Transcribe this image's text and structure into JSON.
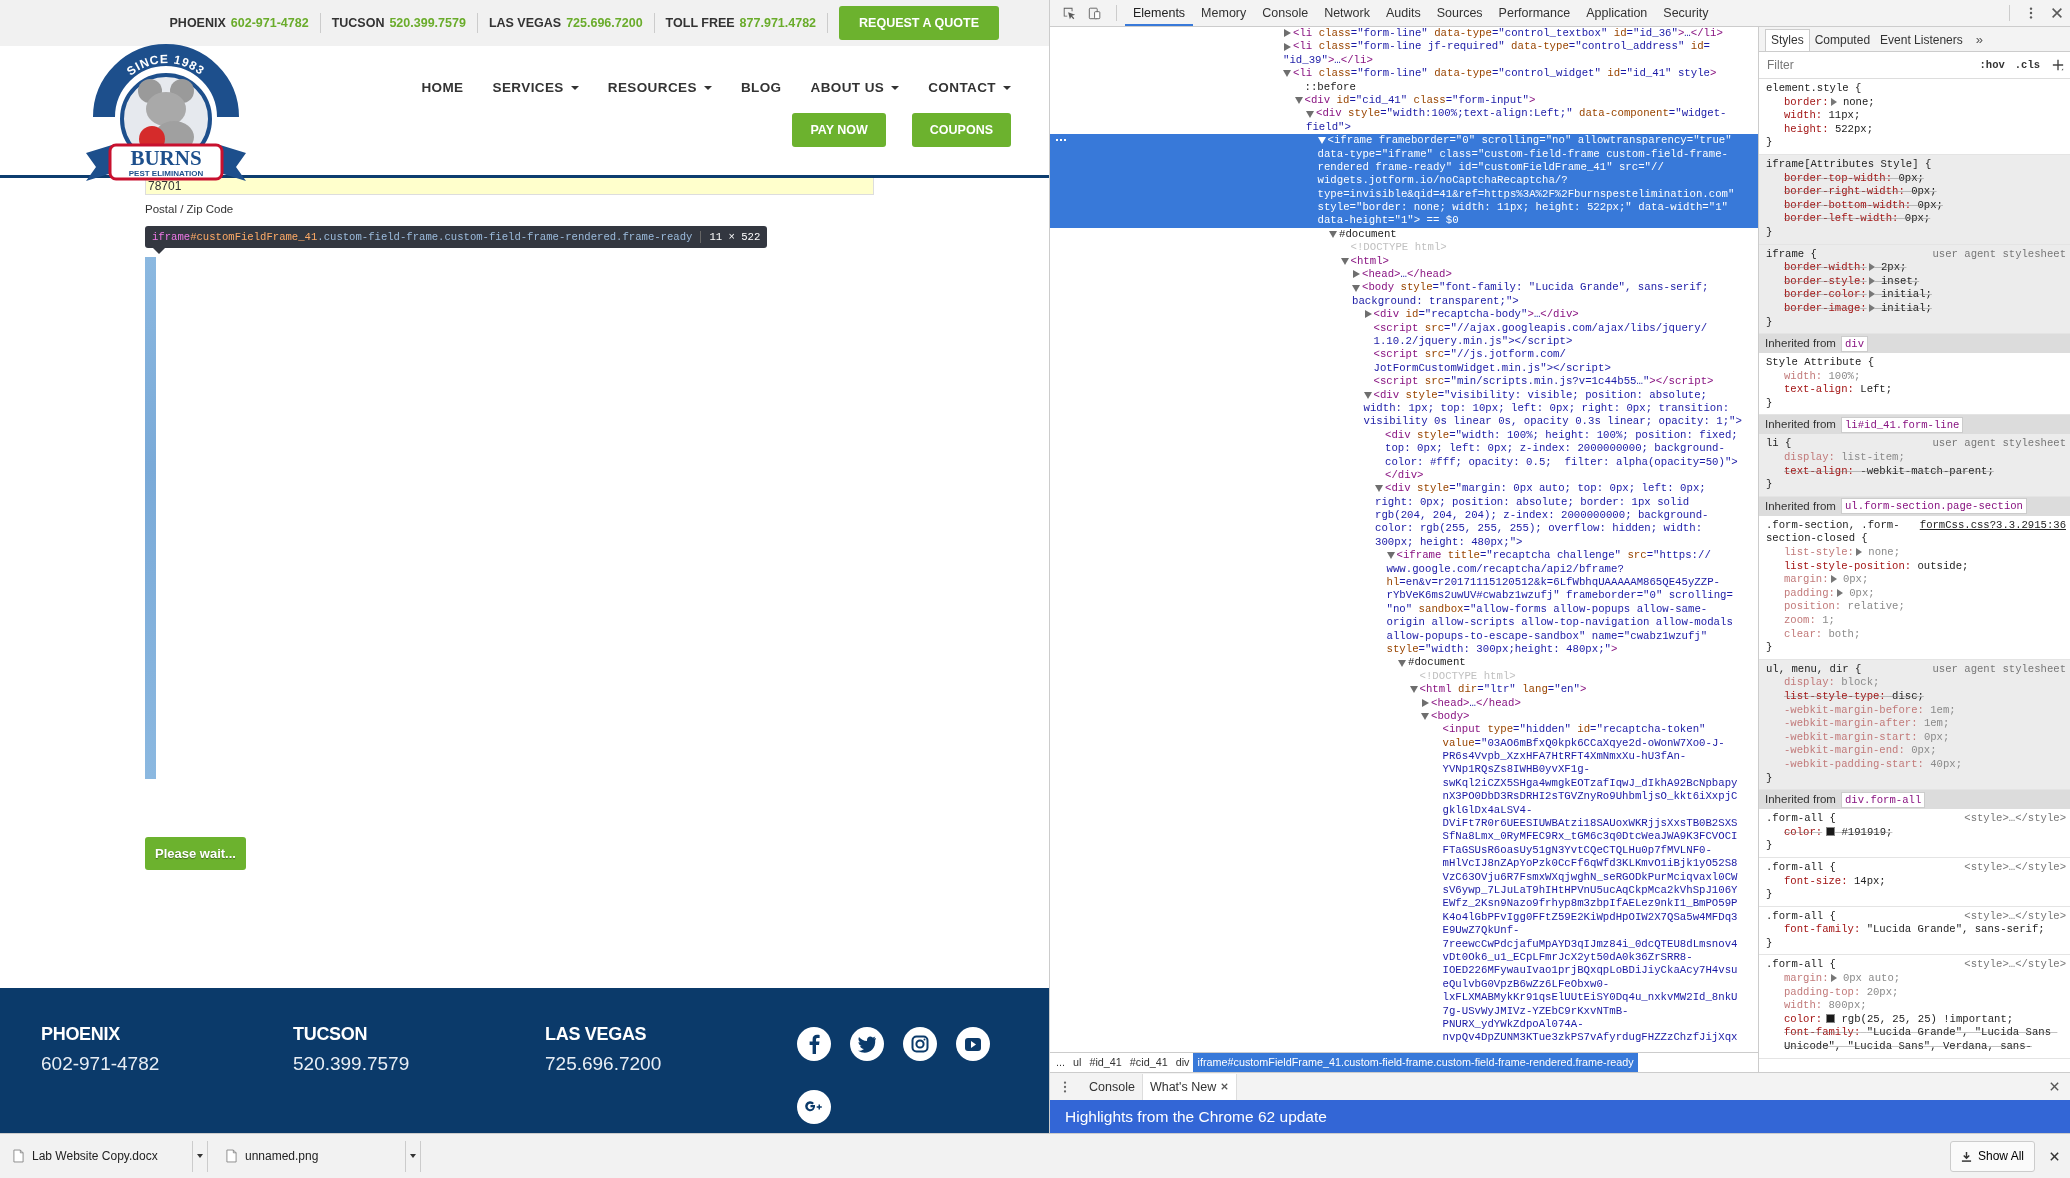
{
  "site": {
    "topbar": {
      "locations": [
        {
          "city": "PHOENIX",
          "phone": "602-971-4782"
        },
        {
          "city": "TUCSON",
          "phone": "520.399.7579"
        },
        {
          "city": "LAS VEGAS",
          "phone": "725.696.7200"
        },
        {
          "city": "TOLL FREE",
          "phone": "877.971.4782"
        }
      ],
      "quote_button": "REQUEST A QUOTE"
    },
    "logo": {
      "arc_text": "SINCE 1983",
      "name": "BURNS",
      "tagline": "PEST ELIMINATION"
    },
    "nav": [
      {
        "label": "HOME",
        "dropdown": false
      },
      {
        "label": "SERVICES",
        "dropdown": true
      },
      {
        "label": "RESOURCES",
        "dropdown": true
      },
      {
        "label": "BLOG",
        "dropdown": false
      },
      {
        "label": "ABOUT US",
        "dropdown": true
      },
      {
        "label": "CONTACT",
        "dropdown": true
      }
    ],
    "header_buttons": [
      "PAY NOW",
      "COUPONS"
    ],
    "form": {
      "zip_value": "78701",
      "zip_label": "Postal / Zip Code",
      "submit": "Please wait..."
    },
    "inspect_tooltip": {
      "tag": "iframe",
      "id": "#customFieldFrame_41",
      "classes": ".custom-field-frame.custom-field-frame-rendered.frame-ready",
      "size": "11 × 522"
    },
    "footer": {
      "offices": [
        {
          "city": "PHOENIX",
          "phone": "602-971-4782"
        },
        {
          "city": "TUCSON",
          "phone": "520.399.7579"
        },
        {
          "city": "LAS VEGAS",
          "phone": "725.696.7200"
        }
      ]
    }
  },
  "devtools": {
    "tabs": [
      {
        "label": "Elements",
        "selected": true
      },
      {
        "label": "Memory",
        "selected": false
      },
      {
        "label": "Console",
        "selected": false
      },
      {
        "label": "Network",
        "selected": false
      },
      {
        "label": "Audits",
        "selected": false
      },
      {
        "label": "Sources",
        "selected": false
      },
      {
        "label": "Performance",
        "selected": false
      },
      {
        "label": "Application",
        "selected": false
      },
      {
        "label": "Security",
        "selected": false
      }
    ],
    "dom_tree": [
      {
        "kind": "element",
        "lines": [
          "<li class=\"form-line\" data-type=\"control_textbox\" id=\"id_36\">…</li>"
        ],
        "expanded": false,
        "selected": false
      },
      {
        "kind": "element",
        "lines": [
          "<li class=\"form-line jf-required\" data-type=\"control_address\" id=",
          "\"id_39\">…</li>"
        ],
        "expanded": false,
        "selected": false
      },
      {
        "kind": "element",
        "lines": [
          "<li class=\"form-line\" data-type=\"control_widget\" id=\"id_41\" style>"
        ],
        "expanded": true,
        "selected": false,
        "children": [
          {
            "kind": "pseudo",
            "lines": [
              "::before"
            ],
            "selected": false
          },
          {
            "kind": "element",
            "lines": [
              "<div id=\"cid_41\" class=\"form-input\">"
            ],
            "expanded": true,
            "selected": false,
            "children": [
              {
                "kind": "element",
                "lines": [
                  "<div style=\"width:100%;text-align:Left;\" data-component=\"widget-",
                  "field\">"
                ],
                "expanded": true,
                "selected": false,
                "children": [
                  {
                    "kind": "element",
                    "lines": [
                      "<iframe frameborder=\"0\" scrolling=\"no\" allowtransparency=\"true\"",
                      "data-type=\"iframe\" class=\"custom-field-frame custom-field-frame-",
                      "rendered frame-ready\" id=\"customFieldFrame_41\" src=\"//",
                      "widgets.jotform.io/noCaptchaRecaptcha/?",
                      "type=invisible&qid=41&ref=https%3A%2F%2Fburnspestelimination.com\"",
                      "style=\"border: none; width: 11px; height: 522px;\" data-width=\"1\"",
                      "data-height=\"1\"> == $0"
                    ],
                    "expanded": true,
                    "selected": true,
                    "children": [
                      {
                        "kind": "document",
                        "lines": [
                          "#document"
                        ],
                        "expanded": true,
                        "selected": false,
                        "children": [
                          {
                            "kind": "doctype",
                            "lines": [
                              "<!DOCTYPE html>"
                            ],
                            "selected": false
                          },
                          {
                            "kind": "element",
                            "lines": [
                              "<html>"
                            ],
                            "expanded": true,
                            "selected": false,
                            "children": [
                              {
                                "kind": "element",
                                "lines": [
                                  "<head>…</head>"
                                ],
                                "expanded": false,
                                "selected": false
                              },
                              {
                                "kind": "element",
                                "lines": [
                                  "<body style=\"font-family: \"Lucida Grande\", sans-serif;",
                                  "background: transparent;\">"
                                ],
                                "expanded": true,
                                "selected": false,
                                "children": [
                                  {
                                    "kind": "element",
                                    "lines": [
                                      "<div id=\"recaptcha-body\">…</div>"
                                    ],
                                    "expanded": false,
                                    "selected": false
                                  },
                                  {
                                    "kind": "element",
                                    "lines": [
                                      "<script src=\"//ajax.googleapis.com/ajax/libs/jquery/",
                                      "1.10.2/jquery.min.js\"></script>"
                                    ],
                                    "selected": false
                                  },
                                  {
                                    "kind": "element",
                                    "lines": [
                                      "<script src=\"//js.jotform.com/",
                                      "JotFormCustomWidget.min.js\"></script>"
                                    ],
                                    "selected": false
                                  },
                                  {
                                    "kind": "element",
                                    "lines": [
                                      "<script src=\"min/scripts.min.js?v=1c44b55…\"></script>"
                                    ],
                                    "selected": false
                                  },
                                  {
                                    "kind": "element",
                                    "lines": [
                                      "<div style=\"visibility: visible; position: absolute;",
                                      "width: 1px; top: 10px; left: 0px; right: 0px; transition:",
                                      "visibility 0s linear 0s, opacity 0.3s linear; opacity: 1;\">"
                                    ],
                                    "expanded": true,
                                    "selected": false,
                                    "children": [
                                      {
                                        "kind": "element",
                                        "lines": [
                                          "<div style=\"width: 100%; height: 100%; position: fixed;",
                                          "top: 0px; left: 0px; z-index: 2000000000; background-",
                                          "color: #fff; opacity: 0.5;  filter: alpha(opacity=50)\">",
                                          "</div>"
                                        ],
                                        "selected": false
                                      },
                                      {
                                        "kind": "element",
                                        "lines": [
                                          "<div style=\"margin: 0px auto; top: 0px; left: 0px;",
                                          "right: 0px; position: absolute; border: 1px solid",
                                          "rgb(204, 204, 204); z-index: 2000000000; background-",
                                          "color: rgb(255, 255, 255); overflow: hidden; width:",
                                          "300px; height: 480px;\">"
                                        ],
                                        "expanded": true,
                                        "selected": false,
                                        "children": [
                                          {
                                            "kind": "element",
                                            "lines": [
                                              "<iframe title=\"recaptcha challenge\" src=\"https://",
                                              "www.google.com/recaptcha/api2/bframe?",
                                              "hl=en&v=r20171115120512&k=6LfWbhqUAAAAAM865QE45yZZP-",
                                              "rYbVeK6ms2uwUV#cwabz1wzufj\" frameborder=\"0\" scrolling=",
                                              "\"no\" sandbox=\"allow-forms allow-popups allow-same-",
                                              "origin allow-scripts allow-top-navigation allow-modals",
                                              "allow-popups-to-escape-sandbox\" name=\"cwabz1wzufj\"",
                                              "style=\"width: 300px;height: 480px;\">"
                                            ],
                                            "expanded": true,
                                            "selected": false,
                                            "children": [
                                              {
                                                "kind": "document",
                                                "lines": [
                                                  "#document"
                                                ],
                                                "expanded": true,
                                                "selected": false,
                                                "children": [
                                                  {
                                                    "kind": "doctype",
                                                    "lines": [
                                                      "<!DOCTYPE html>"
                                                    ],
                                                    "selected": false
                                                  },
                                                  {
                                                    "kind": "element",
                                                    "lines": [
                                                      "<html dir=\"ltr\" lang=\"en\">"
                                                    ],
                                                    "expanded": true,
                                                    "selected": false,
                                                    "children": [
                                                      {
                                                        "kind": "element",
                                                        "lines": [
                                                          "<head>…</head>"
                                                        ],
                                                        "expanded": false,
                                                        "selected": false
                                                      },
                                                      {
                                                        "kind": "element",
                                                        "lines": [
                                                          "<body>"
                                                        ],
                                                        "expanded": true,
                                                        "selected": false,
                                                        "children": [
                                                          {
                                                            "kind": "element",
                                                            "lines": [
                                                              "<input type=\"hidden\" id=\"recaptcha-token\"",
                                                              "value=\"03AO6mBfxQ0kpk6CCaXqye2d-oWonW7Xo0-J-",
                                                              "PR6s4Vvpb_XzxHFA7HtRFT4XmNmxXu-hU3fAn-",
                                                              "YVNp1RQsZs8IWHB0yvXF1g-",
                                                              "swKql2iCZX5SHga4wmgkEOTzafIqwJ_dIkhA92BcNpbapy",
                                                              "nX3PO0DbD3RsDRHI2sTGVZnyRo9UhbmljsO_kkt6iXxpjC",
                                                              "gklGlDx4aLSV4-",
                                                              "DViFt7R0r6UEESIUWBAtzi18SAUoxWKRjjsXxsTB0B2SXS",
                                                              "SfNa8Lmx_0RyMFEC9Rx_tGM6c3q0DtcWeaJWA9K3FCVOCI",
                                                              "FTaGSUsR6oasUy51gN3YvtCQeCTQLHu0p7fMVLNF0-",
                                                              "mHlVcIJ8nZApYoPzk0CcFf6qWfd3KLKmvO1iBjk1yO52S8",
                                                              "VzC63OVju6R7FsmxWXqjwghN_seRGODkPurMciqvaxl0CW",
                                                              "sV6ywp_7LJuLaT9hIHtHPVnU5ucAqCkpMca2kVhSpJ106Y",
                                                              "EWfz_2Ksn9Nazo9frhyp8m3zbpIfAELez9nkI1_BmPO59P",
                                                              "K4o4lGbPFvIgg0FFtZ59E2KiWpdHpOIW2X7QSa5w4MFDq3",
                                                              "E9UwZ7QkUnf-",
                                                              "7reewcCwPdcjafuMpAYD3qIJmz84i_0dcQTEU8dLmsnov4",
                                                              "vDt0Ok6_u1_ECpLFmrJcX2yt50dA0k36ZrSRR8-",
                                                              "IOED226MFywauIvao1prjBQxqpLoBDiJiyCkaAcy7H4vsu",
                                                              "eQulvbG0VpzB6wZz6LFeObxw0-",
                                                              "lxFLXMABMykKr91qsElUUtEiSY0Dq4u_nxkvMW2Id_8nkU",
                                                              "7g-USvWyJMIVz-YZEbC9rKxvNTmB-",
                                                              "PNURX_ydYWkZdpoAl074A-",
                                                              "nvpQv4DpZUNM3KTue3zkPS7vAfyrdugFHZZzChzfJijXqx"
                                                            ],
                                                            "selected": false
                                                          }
                                                        ]
                                                      }
                                                    ]
                                                  }
                                                ]
                                              }
                                            ]
                                          }
                                        ]
                                      }
                                    ]
                                  }
                                ]
                              }
                            ]
                          }
                        ]
                      }
                    ]
                  }
                ]
              }
            ]
          }
        ]
      }
    ],
    "breadcrumbs": [
      {
        "label": "...",
        "selected": false
      },
      {
        "label": "ul",
        "selected": false
      },
      {
        "label": "#id_41",
        "selected": false
      },
      {
        "label": "#cid_41",
        "selected": false
      },
      {
        "label": "div",
        "selected": false
      },
      {
        "label": "iframe#customFieldFrame_41.custom-field-frame.custom-field-frame-rendered.frame-ready",
        "selected": true
      }
    ],
    "sidebar_tabs": [
      {
        "label": "Styles",
        "selected": true
      },
      {
        "label": "Computed",
        "selected": false
      },
      {
        "label": "Event Listeners",
        "selected": false
      }
    ],
    "sidebar_more": "»",
    "filter": {
      "placeholder": "Filter",
      "toggles": [
        ":hov",
        ".cls"
      ]
    },
    "style_rules": [
      {
        "kind": "rule",
        "shaded": false,
        "selector": "element.style {",
        "props": [
          {
            "name": "border:",
            "value": "none;",
            "inactive": false,
            "overridden": false,
            "expandable": true
          },
          {
            "name": "width:",
            "value": "11px;",
            "inactive": false,
            "overridden": false
          },
          {
            "name": "height:",
            "value": "522px;",
            "inactive": false,
            "overridden": false
          }
        ],
        "end": "}"
      },
      {
        "kind": "rule",
        "shaded": true,
        "selector": "iframe[Attributes Style] {",
        "props": [
          {
            "name": "border-top-width:",
            "value": "0px;",
            "inactive": false,
            "overridden": true
          },
          {
            "name": "border-right-width:",
            "value": "0px;",
            "inactive": false,
            "overridden": true
          },
          {
            "name": "border-bottom-width:",
            "value": "0px;",
            "inactive": false,
            "overridden": true
          },
          {
            "name": "border-left-width:",
            "value": "0px;",
            "inactive": false,
            "overridden": true
          }
        ],
        "end": "}"
      },
      {
        "kind": "rule",
        "shaded": true,
        "source_link": false,
        "selector": "iframe {",
        "source": "user agent stylesheet",
        "props": [
          {
            "name": "border-width:",
            "value": "2px;",
            "inactive": false,
            "overridden": true,
            "expandable": true
          },
          {
            "name": "border-style:",
            "value": "inset;",
            "inactive": false,
            "overridden": true,
            "expandable": true
          },
          {
            "name": "border-color:",
            "value": "initial;",
            "inactive": false,
            "overridden": true,
            "expandable": true
          },
          {
            "name": "border-image:",
            "value": "initial;",
            "inactive": false,
            "overridden": true,
            "expandable": true
          }
        ],
        "end": "}"
      },
      {
        "kind": "inherited",
        "label": "Inherited from",
        "target": "div"
      },
      {
        "kind": "rule",
        "shaded": false,
        "selector": "Style Attribute {",
        "props": [
          {
            "name": "width:",
            "value": "100%;",
            "inactive": true,
            "overridden": false
          },
          {
            "name": "text-align:",
            "value": "Left;",
            "inactive": false,
            "overridden": false
          }
        ],
        "end": "}"
      },
      {
        "kind": "inherited",
        "label": "Inherited from",
        "target": "li#id_41.form-line"
      },
      {
        "kind": "rule",
        "shaded": true,
        "source_link": false,
        "selector": "li {",
        "source": "user agent stylesheet",
        "props": [
          {
            "name": "display:",
            "value": "list-item;",
            "inactive": true,
            "overridden": false
          },
          {
            "name": "text-align:",
            "value": "-webkit-match-parent;",
            "inactive": false,
            "overridden": true
          }
        ],
        "end": "}"
      },
      {
        "kind": "inherited",
        "label": "Inherited from",
        "target": "ul.form-section.page-section"
      },
      {
        "kind": "rule",
        "shaded": false,
        "source_link": true,
        "selector": ".form-section, .form-section-closed {",
        "source": "formCss.css?3.3.2915:36",
        "props": [
          {
            "name": "list-style:",
            "value": "none;",
            "inactive": true,
            "overridden": false,
            "expandable": true
          },
          {
            "name": "list-style-position:",
            "value": "outside;",
            "inactive": false,
            "overridden": false
          },
          {
            "name": "margin:",
            "value": "0px;",
            "inactive": true,
            "overridden": false,
            "expandable": true
          },
          {
            "name": "padding:",
            "value": "0px;",
            "inactive": true,
            "overridden": false,
            "expandable": true
          },
          {
            "name": "position:",
            "value": "relative;",
            "inactive": true,
            "overridden": false
          },
          {
            "name": "zoom:",
            "value": "1;",
            "inactive": true,
            "overridden": false
          },
          {
            "name": "clear:",
            "value": "both;",
            "inactive": true,
            "overridden": false
          }
        ],
        "end": "}"
      },
      {
        "kind": "rule",
        "shaded": true,
        "source_link": false,
        "selector": "ul, menu, dir {",
        "source": "user agent stylesheet",
        "props": [
          {
            "name": "display:",
            "value": "block;",
            "inactive": true,
            "overridden": false
          },
          {
            "name": "list-style-type:",
            "value": "disc;",
            "inactive": false,
            "overridden": true
          },
          {
            "name": "-webkit-margin-before:",
            "value": "1em;",
            "inactive": true,
            "overridden": false
          },
          {
            "name": "-webkit-margin-after:",
            "value": "1em;",
            "inactive": true,
            "overridden": false
          },
          {
            "name": "-webkit-margin-start:",
            "value": "0px;",
            "inactive": true,
            "overridden": false
          },
          {
            "name": "-webkit-margin-end:",
            "value": "0px;",
            "inactive": true,
            "overridden": false
          },
          {
            "name": "-webkit-padding-start:",
            "value": "40px;",
            "inactive": true,
            "overridden": false
          }
        ],
        "end": "}"
      },
      {
        "kind": "inherited",
        "label": "Inherited from",
        "target": "div.form-all"
      },
      {
        "kind": "rule",
        "shaded": false,
        "source_link": false,
        "selector": ".form-all {",
        "source": "<style>…</style>",
        "props": [
          {
            "name": "color:",
            "value": "#191919;",
            "inactive": false,
            "overridden": true,
            "swatch": true
          }
        ],
        "end": "}"
      },
      {
        "kind": "rule",
        "shaded": false,
        "source_link": false,
        "selector": ".form-all {",
        "source": "<style>…</style>",
        "props": [
          {
            "name": "font-size:",
            "value": "14px;",
            "inactive": false,
            "overridden": false
          }
        ],
        "end": "}"
      },
      {
        "kind": "rule",
        "shaded": false,
        "source_link": false,
        "selector": ".form-all {",
        "source": "<style>…</style>",
        "props": [
          {
            "name": "font-family:",
            "value": "\"Lucida Grande\", sans-serif;",
            "inactive": false,
            "overridden": false
          }
        ],
        "end": "}"
      },
      {
        "kind": "rule",
        "shaded": false,
        "source_link": false,
        "selector": ".form-all {",
        "source": "<style>…</style>",
        "props": [
          {
            "name": "margin:",
            "value": "0px auto;",
            "inactive": true,
            "overridden": false,
            "expandable": true
          },
          {
            "name": "padding-top:",
            "value": "20px;",
            "inactive": true,
            "overridden": false
          },
          {
            "name": "width:",
            "value": "800px;",
            "inactive": true,
            "overridden": false
          },
          {
            "name": "color:",
            "value": "rgb(25, 25, 25) !important;",
            "inactive": false,
            "overridden": false,
            "swatch": true
          },
          {
            "name": "font-family:",
            "value": "\"Lucida Grande\", \"Lucida Sans Unicode\", \"Lucida Sans\", Verdana, sans-",
            "inactive": false,
            "overridden": true
          }
        ]
      }
    ],
    "drawer": {
      "tabs": [
        {
          "label": "Console",
          "selected": false,
          "closable": false
        },
        {
          "label": "What's New",
          "selected": true,
          "closable": true
        }
      ],
      "banner": "Highlights from the Chrome 62 update"
    }
  },
  "downloads": {
    "items": [
      "Lab Website Copy.docx",
      "unnamed.png"
    ],
    "show_all": "Show All"
  }
}
